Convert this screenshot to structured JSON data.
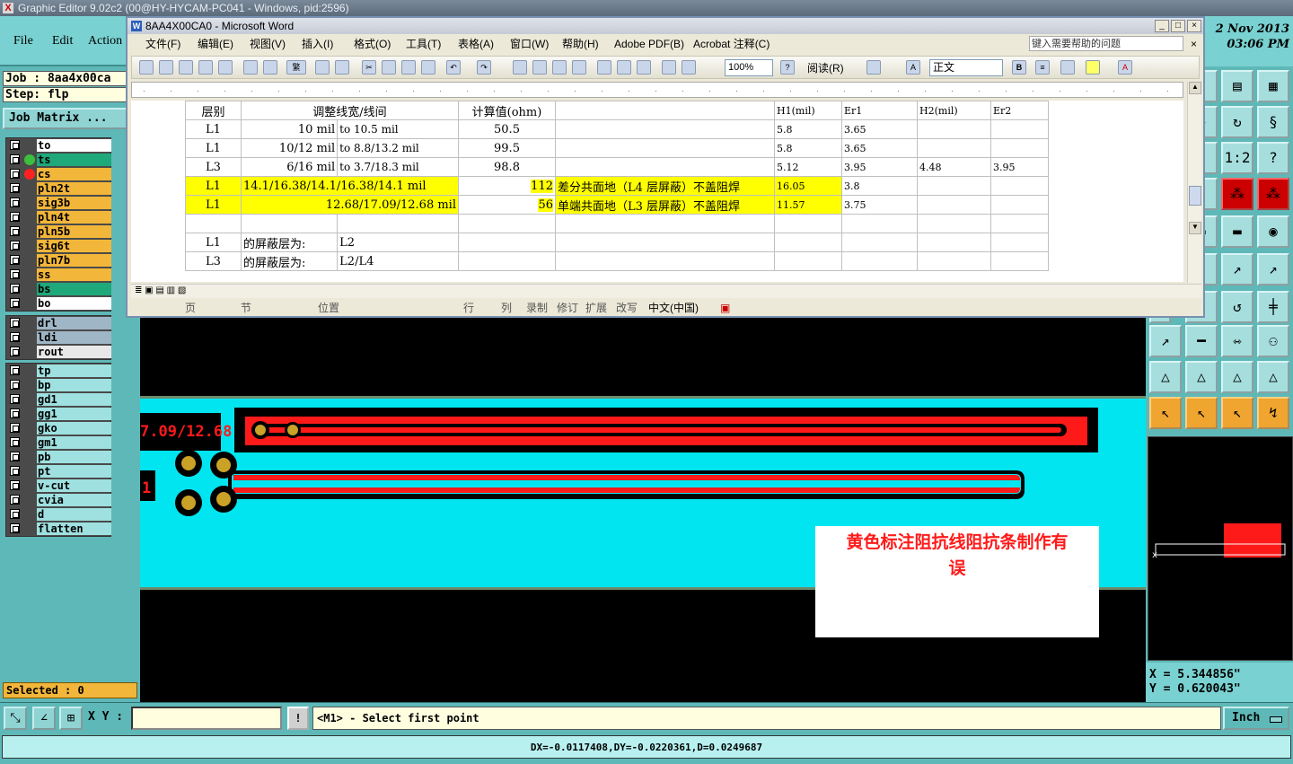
{
  "app": {
    "title": "Graphic Editor 9.02c2 (00@HY-HYCAM-PC041 - Windows, pid:2596)"
  },
  "menu": [
    "File",
    "Edit",
    "Action"
  ],
  "job": {
    "label": "Job : 8aa4x00ca",
    "step": "Step: flp",
    "matrix_button": "Job Matrix ..."
  },
  "layers_group1": [
    {
      "name": "to",
      "color": "#ffffff",
      "indicator": ""
    },
    {
      "name": "ts",
      "color": "#1fa87a",
      "indicator": "#3cbf3c"
    },
    {
      "name": "cs",
      "color": "#f2b63a",
      "indicator": "#ff2020"
    },
    {
      "name": "pln2t",
      "color": "#f2b63a",
      "indicator": ""
    },
    {
      "name": "sig3b",
      "color": "#f2b63a",
      "indicator": ""
    },
    {
      "name": "pln4t",
      "color": "#f2b63a",
      "indicator": ""
    },
    {
      "name": "pln5b",
      "color": "#f2b63a",
      "indicator": ""
    },
    {
      "name": "sig6t",
      "color": "#f2b63a",
      "indicator": ""
    },
    {
      "name": "pln7b",
      "color": "#f2b63a",
      "indicator": ""
    },
    {
      "name": "ss",
      "color": "#f2b63a",
      "indicator": ""
    },
    {
      "name": "bs",
      "color": "#1fa87a",
      "indicator": ""
    },
    {
      "name": "bo",
      "color": "#ffffff",
      "indicator": ""
    }
  ],
  "layers_group2": [
    {
      "name": "drl",
      "color": "#9fb6c6",
      "indicator": ""
    },
    {
      "name": "ldi",
      "color": "#9fb6c6",
      "indicator": ""
    },
    {
      "name": "rout",
      "color": "#e8e8e8",
      "indicator": ""
    }
  ],
  "layers_group3": [
    {
      "name": "tp",
      "color": "#9fe0e0"
    },
    {
      "name": "bp",
      "color": "#9fe0e0"
    },
    {
      "name": "gd1",
      "color": "#9fe0e0"
    },
    {
      "name": "gg1",
      "color": "#9fe0e0"
    },
    {
      "name": "gko",
      "color": "#9fe0e0"
    },
    {
      "name": "gm1",
      "color": "#9fe0e0"
    },
    {
      "name": "pb",
      "color": "#9fe0e0"
    },
    {
      "name": "pt",
      "color": "#9fe0e0"
    },
    {
      "name": "v-cut",
      "color": "#9fe0e0"
    },
    {
      "name": "cvia",
      "color": "#9fe0e0"
    },
    {
      "name": "d",
      "color": "#9fe0e0"
    },
    {
      "name": "flatten",
      "color": "#9fe0e0"
    }
  ],
  "selected": "Selected : 0",
  "datetime": {
    "date": "2 Nov 2013",
    "time": "03:06 PM"
  },
  "coords": {
    "x": "X  =  5.344856\"",
    "y": "Y  =  0.620043\""
  },
  "status": {
    "xy_label": "X Y :",
    "prompt": "<M1> - Select first point",
    "units": "Inch",
    "excl": "!",
    "delta": "DX=-0.0117408,DY=-0.0220361,D=0.0249687"
  },
  "canvas": {
    "label_left": "7.09/12.68",
    "label_left2": "1",
    "note": "黄色标注阻抗线阻抗条制作有误"
  },
  "word": {
    "title": "8AA4X00CA0 - Microsoft Word",
    "menus": [
      "文件(F)",
      "编辑(E)",
      "视图(V)",
      "插入(I)",
      "格式(O)",
      "工具(T)",
      "表格(A)",
      "窗口(W)",
      "帮助(H)",
      "Adobe PDF(B)",
      "Acrobat 注释(C)"
    ],
    "help_placeholder": "键入需要帮助的问题",
    "zoom": "100%",
    "reading": "阅读(R)",
    "style": "正文",
    "status": [
      "页",
      "节",
      "位置",
      "行",
      "列",
      "录制",
      "修订",
      "扩展",
      "改写",
      "中文(中国)"
    ],
    "table": {
      "header": [
        "层别",
        "调整线宽/线间",
        "计算值(ohm)",
        "H1(mil)",
        "Er1",
        "H2(mil)",
        "Er2"
      ],
      "rows": [
        {
          "layer": "L1",
          "width": "10 mil",
          "to": "to  10.5 mil",
          "calc": "50.5",
          "desc": "",
          "h1": "5.8",
          "er1": "3.65",
          "h2": "",
          "er2": "",
          "hl": false
        },
        {
          "layer": "L1",
          "width": "10/12 mil",
          "to": "to  8.8/13.2 mil",
          "calc": "99.5",
          "desc": "",
          "h1": "5.8",
          "er1": "3.65",
          "h2": "",
          "er2": "",
          "hl": false
        },
        {
          "layer": "L3",
          "width": "6/16 mil",
          "to": "to  3.7/18.3 mil",
          "calc": "98.8",
          "desc": "",
          "h1": "5.12",
          "er1": "3.95",
          "h2": "4.48",
          "er2": "3.95",
          "hl": false
        },
        {
          "layer": "L1",
          "width": "14.1/16.38/14.1/16.38/14.1 mil",
          "to": "",
          "calc": "112",
          "desc": "差分共面地（L4 层屏蔽）不盖阻焊",
          "h1": "16.05",
          "er1": "3.8",
          "h2": "",
          "er2": "",
          "hl": true
        },
        {
          "layer": "L1",
          "width": "12.68/17.09/12.68 mil",
          "to": "",
          "calc": "56",
          "desc": "单端共面地（L3 层屏蔽）不盖阻焊",
          "h1": "11.57",
          "er1": "3.75",
          "h2": "",
          "er2": "",
          "hl": true
        }
      ],
      "shield": [
        {
          "layer": "L1",
          "text": "的屏蔽层为:",
          "value": "L2"
        },
        {
          "layer": "L3",
          "text": "的屏蔽层为:",
          "value": "L2/L4"
        }
      ]
    }
  },
  "colors": {
    "cyan": "#00e5f0",
    "copper": "#ff1a1a",
    "pad": "#c9a227",
    "panel": "#5fb8b8"
  }
}
